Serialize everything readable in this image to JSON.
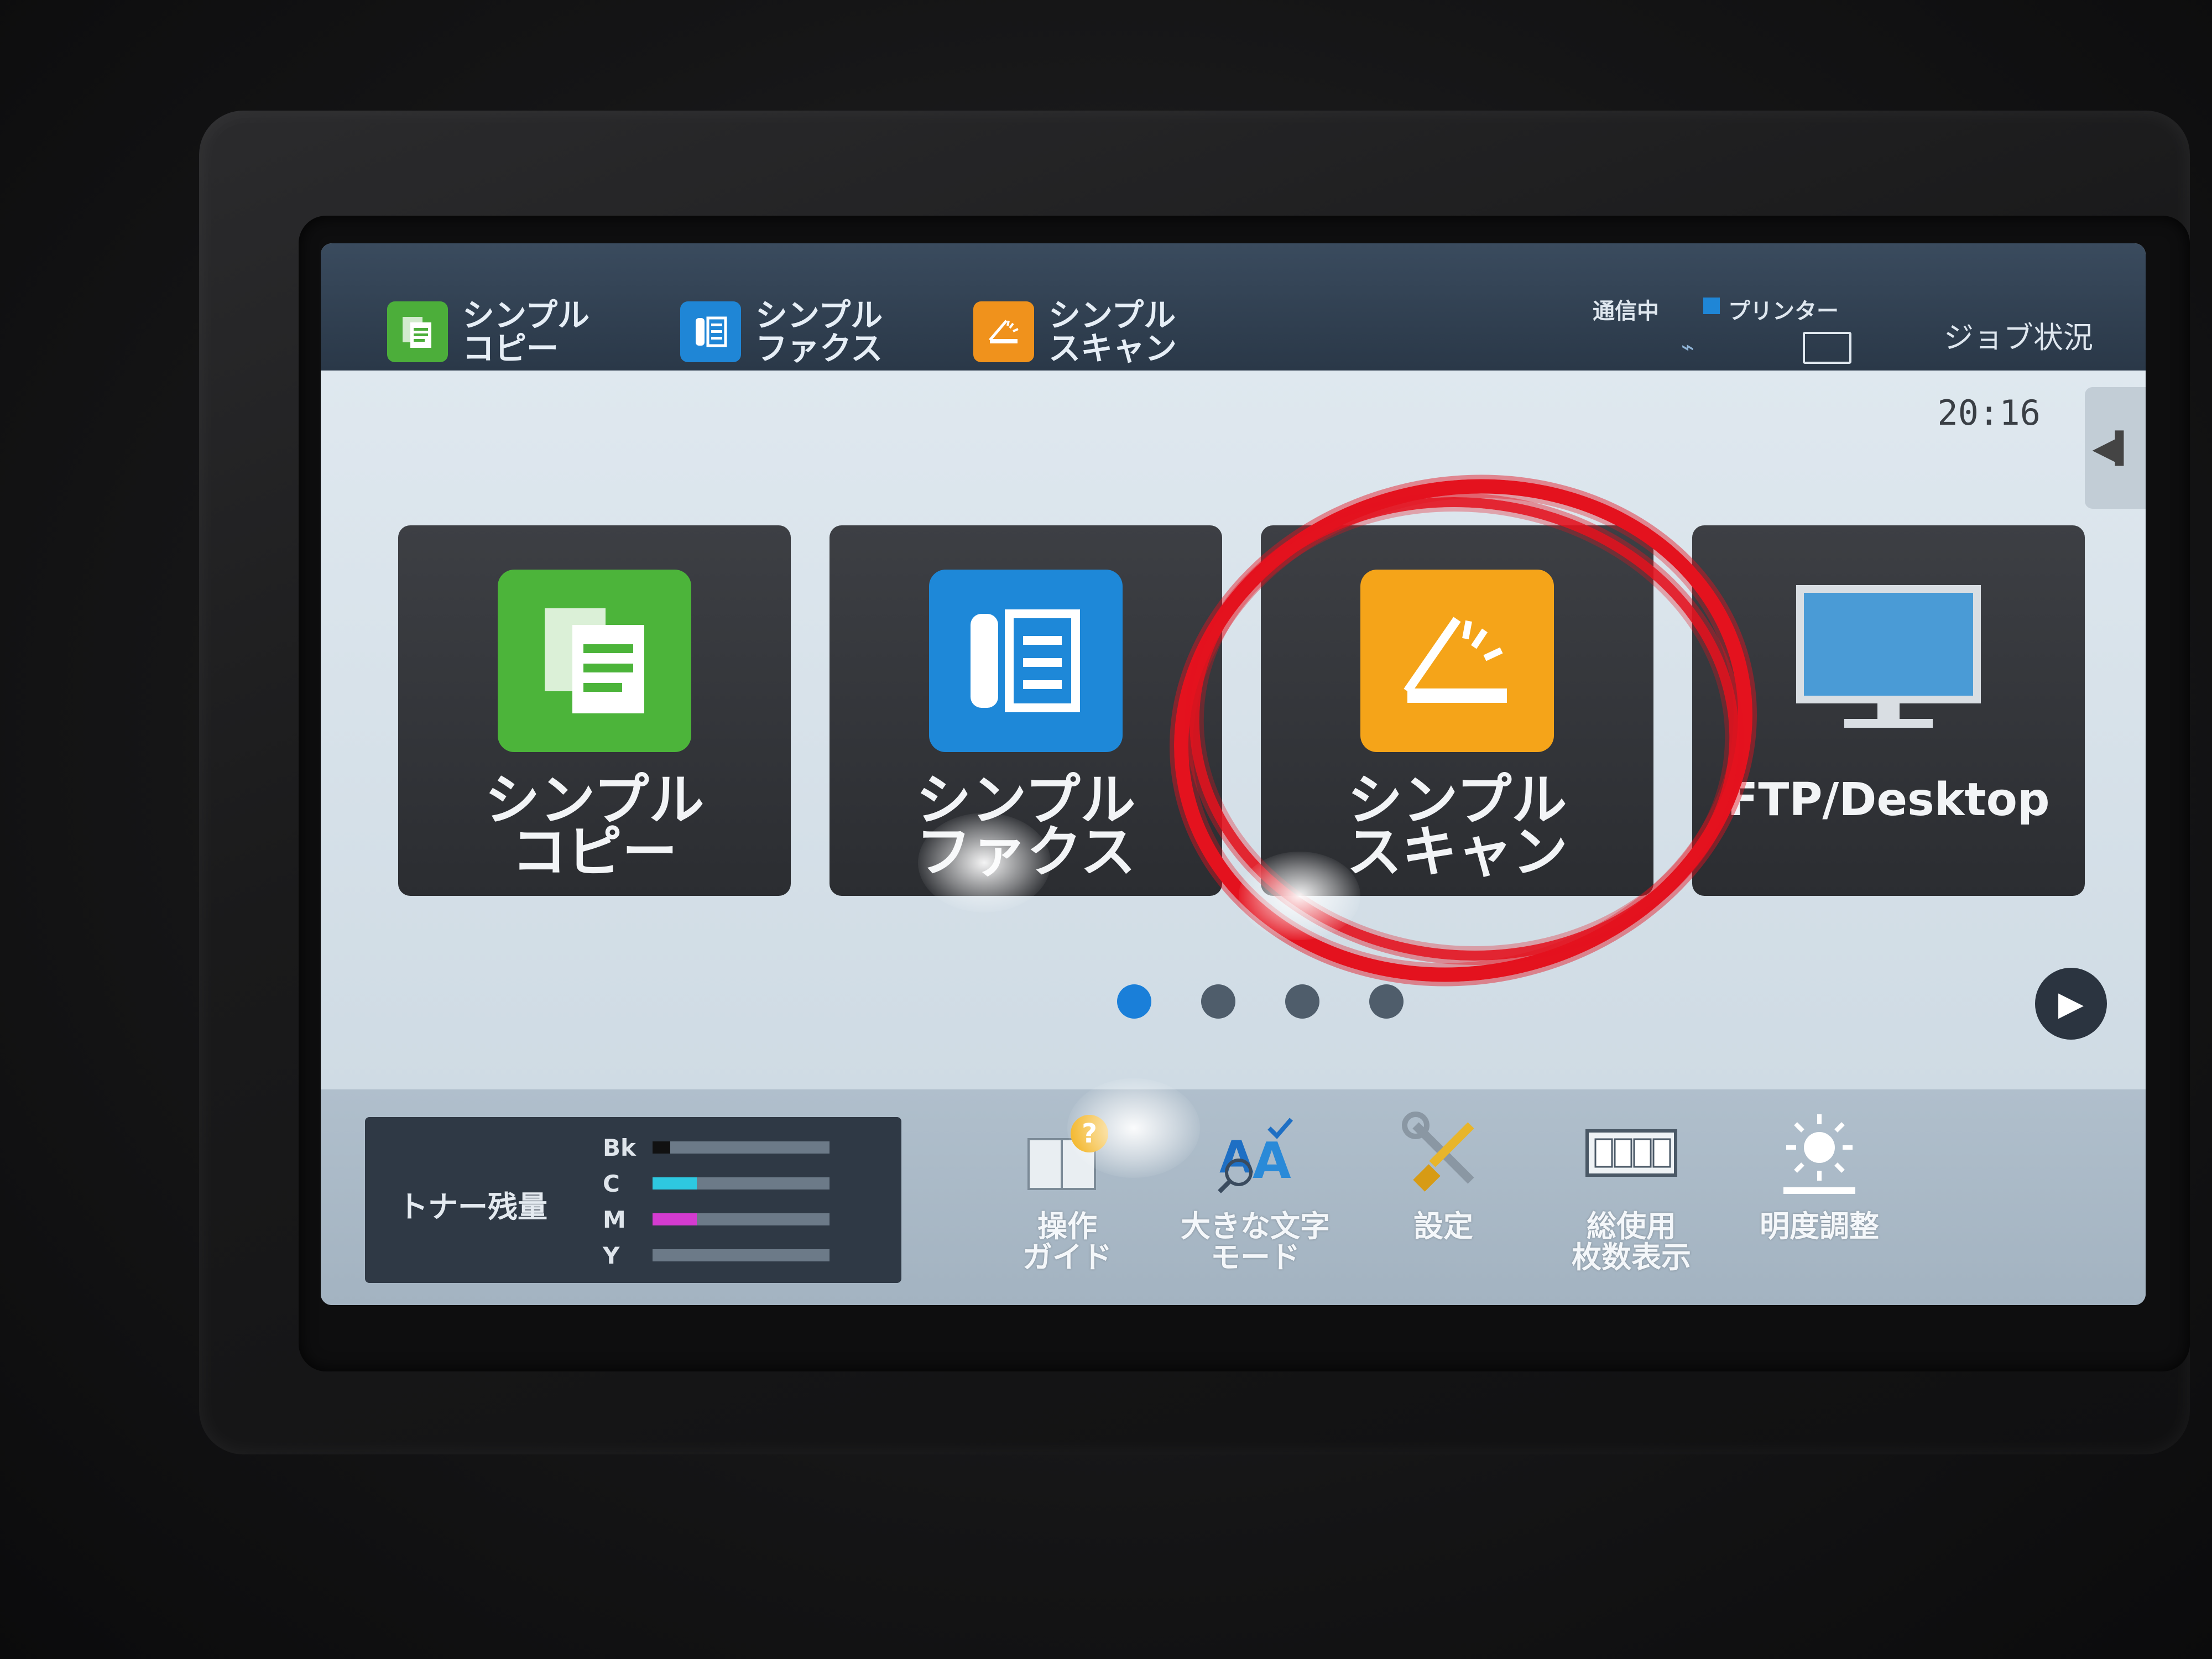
{
  "top_bar": {
    "tabs": [
      {
        "label": "シンプル\nコピー",
        "color": "#4cae3a"
      },
      {
        "label": "シンプル\nファクス",
        "color": "#1f86d6"
      },
      {
        "label": "シンプル\nスキャン",
        "color": "#f0921c"
      }
    ],
    "status_comm": "通信中",
    "status_printer": "プリンター",
    "job_status": "ジョブ状況"
  },
  "main": {
    "clock": "20:16",
    "tiles": [
      {
        "label": "シンプル\nコピー",
        "icon": "copy-icon",
        "color": "#4cb43a"
      },
      {
        "label": "シンプル\nファクス",
        "icon": "fax-icon",
        "color": "#1e88d8"
      },
      {
        "label": "シンプル\nスキャン",
        "icon": "scan-icon",
        "color": "#f5a419"
      },
      {
        "label": "FTP/Desktop",
        "icon": "monitor-icon",
        "color": "#4a9bd6"
      }
    ],
    "page_count": 4,
    "active_page": 1,
    "highlight_color": "#e4121e"
  },
  "bottom": {
    "toner": {
      "title": "トナー残量",
      "rows": [
        {
          "label": "Bk",
          "level": 0.1,
          "color": "#111111"
        },
        {
          "label": "C",
          "level": 0.25,
          "color": "#2ec8e0"
        },
        {
          "label": "M",
          "level": 0.25,
          "color": "#d43bd0"
        },
        {
          "label": "Y",
          "level": 0.0,
          "color": "#e8d21a"
        }
      ]
    },
    "tools": [
      {
        "label": "操作\nガイド",
        "icon": "guide-icon"
      },
      {
        "label": "大きな文字\nモード",
        "icon": "large-text-icon"
      },
      {
        "label": "設定",
        "icon": "settings-icon"
      },
      {
        "label": "総使用\n枚数表示",
        "icon": "counter-icon"
      },
      {
        "label": "明度調整",
        "icon": "brightness-icon"
      }
    ]
  }
}
